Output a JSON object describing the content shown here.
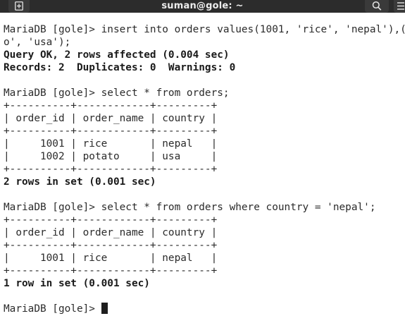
{
  "window": {
    "title": "suman@gole: ~",
    "newtab_icon": "new-tab-icon",
    "search_icon": "search-icon",
    "menu_icon": "hamburger-menu-icon"
  },
  "terminal": {
    "lines": [
      "MariaDB [gole]> insert into orders values(1001, 'rice', 'nepal'),(1002, 'potat",
      "o', 'usa');",
      "Query OK, 2 rows affected (0.004 sec)",
      "Records: 2  Duplicates: 0  Warnings: 0",
      "",
      "MariaDB [gole]> select * from orders;",
      "+----------+------------+---------+",
      "| order_id | order_name | country |",
      "+----------+------------+---------+",
      "|     1001 | rice       | nepal   |",
      "|     1002 | potato     | usa     |",
      "+----------+------------+---------+",
      "2 rows in set (0.001 sec)",
      "",
      "MariaDB [gole]> select * from orders where country = 'nepal';",
      "+----------+------------+---------+",
      "| order_id | order_name | country |",
      "+----------+------------+---------+",
      "|     1001 | rice       | nepal   |",
      "+----------+------------+---------+",
      "1 row in set (0.001 sec)",
      ""
    ],
    "prompt": "MariaDB [gole]> "
  }
}
